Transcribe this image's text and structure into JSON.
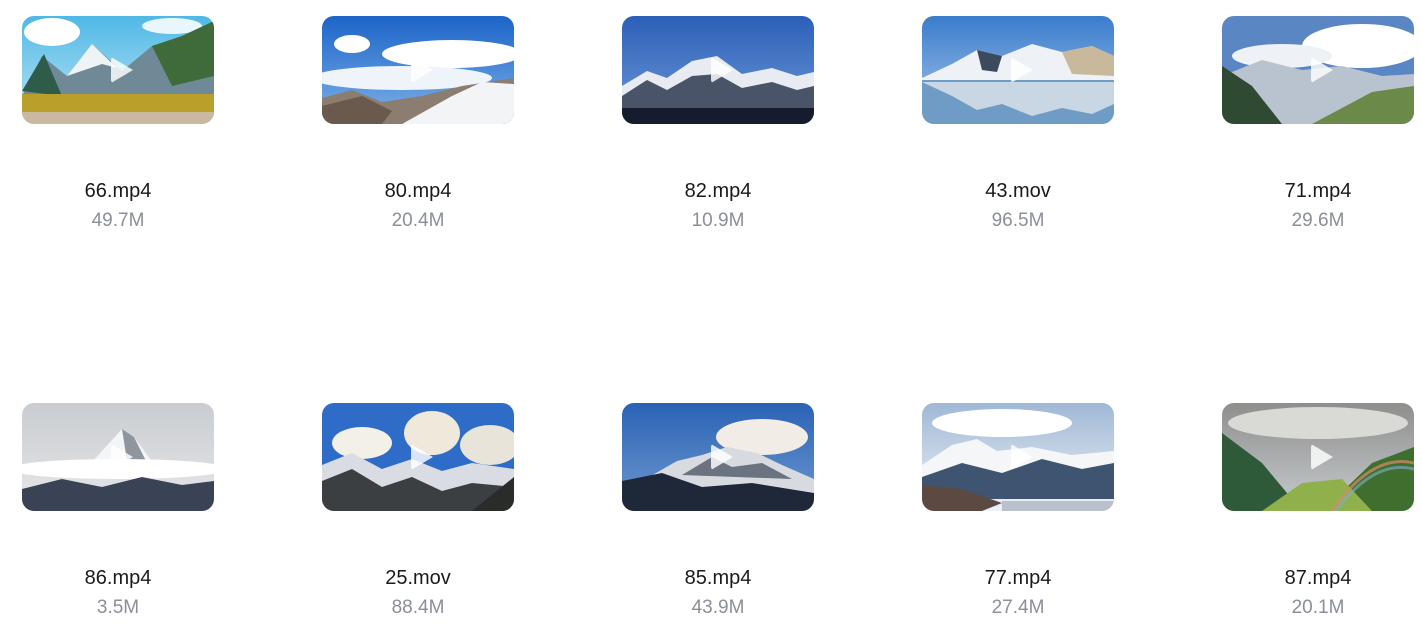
{
  "files": [
    {
      "name": "66.mp4",
      "size": "49.7M",
      "thumbnail": "mountain-valley-autumn-icon"
    },
    {
      "name": "80.mp4",
      "size": "20.4M",
      "thumbnail": "snowy-ridge-clouds-icon"
    },
    {
      "name": "82.mp4",
      "size": "10.9M",
      "thumbnail": "snow-peaks-blue-sky-icon"
    },
    {
      "name": "43.mov",
      "size": "96.5M",
      "thumbnail": "lake-reflection-mountains-icon"
    },
    {
      "name": "71.mp4",
      "size": "29.6M",
      "thumbnail": "cloudy-green-valley-icon"
    },
    {
      "name": "86.mp4",
      "size": "3.5M",
      "thumbnail": "misty-peak-icon"
    },
    {
      "name": "25.mov",
      "size": "88.4M",
      "thumbnail": "peaks-puffy-clouds-icon"
    },
    {
      "name": "85.mp4",
      "size": "43.9M",
      "thumbnail": "rocky-summit-cloud-icon"
    },
    {
      "name": "77.mp4",
      "size": "27.4M",
      "thumbnail": "snowy-range-river-icon"
    },
    {
      "name": "87.mp4",
      "size": "20.1M",
      "thumbnail": "valley-rainbow-icon"
    }
  ],
  "colors": {
    "filename": "#1a1a1a",
    "filesize": "#8a8f99",
    "play_icon": "#ffffff"
  }
}
